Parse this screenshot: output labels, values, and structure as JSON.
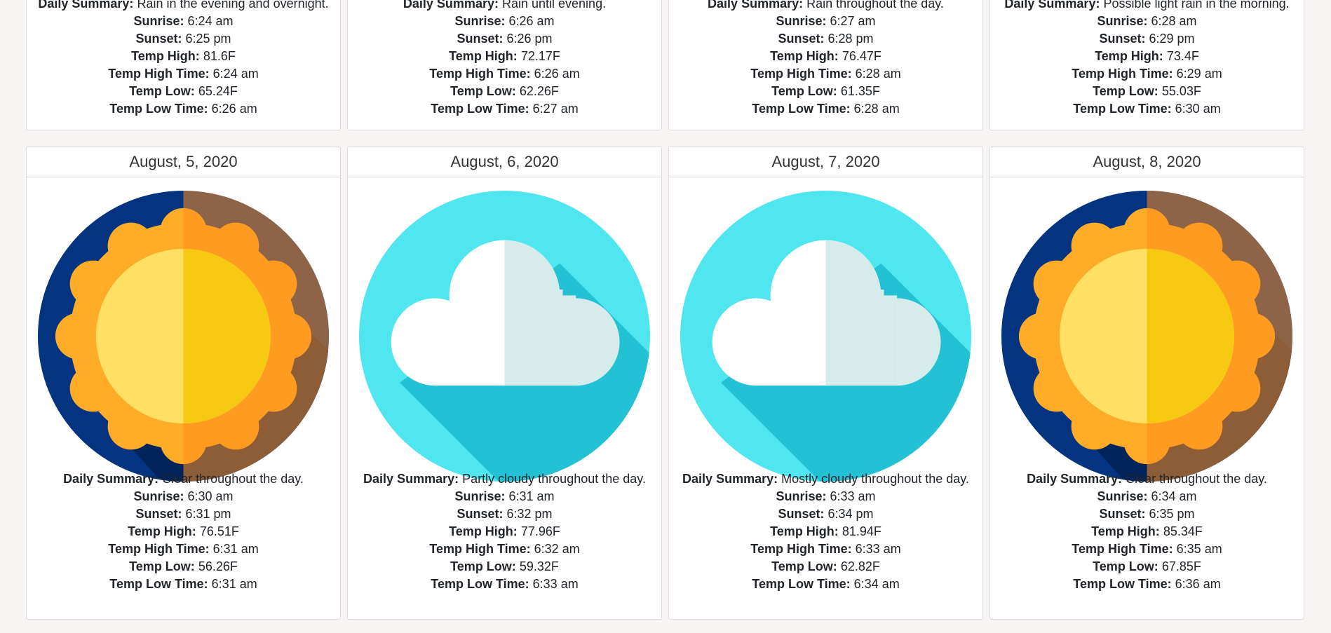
{
  "labels": {
    "summary": "Daily Summary:",
    "sunrise": "Sunrise:",
    "sunset": "Sunset:",
    "temp_high": "Temp High:",
    "temp_high_time": "Temp High Time:",
    "temp_low": "Temp Low:",
    "temp_low_time": "Temp Low Time:"
  },
  "top_cards": [
    {
      "summary": "Rain in the evening and overnight.",
      "sunrise": "6:24 am",
      "sunset": "6:25 pm",
      "temp_high": "81.6F",
      "temp_high_time": "6:24 am",
      "temp_low": "65.24F",
      "temp_low_time": "6:26 am"
    },
    {
      "summary": "Rain until evening.",
      "sunrise": "6:26 am",
      "sunset": "6:26 pm",
      "temp_high": "72.17F",
      "temp_high_time": "6:26 am",
      "temp_low": "62.26F",
      "temp_low_time": "6:27 am"
    },
    {
      "summary": "Rain throughout the day.",
      "sunrise": "6:27 am",
      "sunset": "6:28 pm",
      "temp_high": "76.47F",
      "temp_high_time": "6:28 am",
      "temp_low": "61.35F",
      "temp_low_time": "6:28 am"
    },
    {
      "summary": "Possible light rain in the morning.",
      "sunrise": "6:28 am",
      "sunset": "6:29 pm",
      "temp_high": "73.4F",
      "temp_high_time": "6:29 am",
      "temp_low": "55.03F",
      "temp_low_time": "6:30 am"
    }
  ],
  "bottom_cards": [
    {
      "date": "August, 5, 2020",
      "icon": "sun-icon",
      "summary": "Clear throughout the day.",
      "sunrise": "6:30 am",
      "sunset": "6:31 pm",
      "temp_high": "76.51F",
      "temp_high_time": "6:31 am",
      "temp_low": "56.26F",
      "temp_low_time": "6:31 am"
    },
    {
      "date": "August, 6, 2020",
      "icon": "cloud-icon",
      "summary": "Partly cloudy throughout the day.",
      "sunrise": "6:31 am",
      "sunset": "6:32 pm",
      "temp_high": "77.96F",
      "temp_high_time": "6:32 am",
      "temp_low": "59.32F",
      "temp_low_time": "6:33 am"
    },
    {
      "date": "August, 7, 2020",
      "icon": "cloud-icon",
      "summary": "Mostly cloudy throughout the day.",
      "sunrise": "6:33 am",
      "sunset": "6:34 pm",
      "temp_high": "81.94F",
      "temp_high_time": "6:33 am",
      "temp_low": "62.82F",
      "temp_low_time": "6:34 am"
    },
    {
      "date": "August, 8, 2020",
      "icon": "sun-icon",
      "summary": "Clear throughout the day.",
      "sunrise": "6:34 am",
      "sunset": "6:35 pm",
      "temp_high": "85.34F",
      "temp_high_time": "6:35 am",
      "temp_low": "67.85F",
      "temp_low_time": "6:36 am"
    }
  ]
}
